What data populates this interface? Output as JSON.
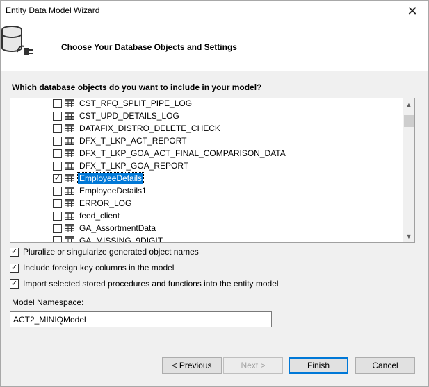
{
  "window": {
    "title": "Entity Data Model Wizard"
  },
  "header": {
    "title": "Choose Your Database Objects and Settings",
    "icon": "database-connect-icon"
  },
  "question": "Which database objects do you want to include in your model?",
  "objects": [
    {
      "label": "CST_RFQ_SPLIT_PIPE_LOG",
      "checked": false,
      "selected": false
    },
    {
      "label": "CST_UPD_DETAILS_LOG",
      "checked": false,
      "selected": false
    },
    {
      "label": "DATAFIX_DISTRO_DELETE_CHECK",
      "checked": false,
      "selected": false
    },
    {
      "label": "DFX_T_LKP_ACT_REPORT",
      "checked": false,
      "selected": false
    },
    {
      "label": "DFX_T_LKP_GOA_ACT_FINAL_COMPARISON_DATA",
      "checked": false,
      "selected": false
    },
    {
      "label": "DFX_T_LKP_GOA_REPORT",
      "checked": false,
      "selected": false
    },
    {
      "label": "EmployeeDetails",
      "checked": true,
      "selected": true
    },
    {
      "label": "EmployeeDetails1",
      "checked": false,
      "selected": false
    },
    {
      "label": "ERROR_LOG",
      "checked": false,
      "selected": false
    },
    {
      "label": "feed_client",
      "checked": false,
      "selected": false
    },
    {
      "label": "GA_AssortmentData",
      "checked": false,
      "selected": false
    },
    {
      "label": "GA_MISSING_9DIGIT",
      "checked": false,
      "selected": false
    }
  ],
  "options": {
    "pluralize": {
      "label": "Pluralize or singularize generated object names",
      "checked": true
    },
    "foreign_keys": {
      "label": "Include foreign key columns in the model",
      "checked": true
    },
    "import_procs": {
      "label": "Import selected stored procedures and functions into the entity model",
      "checked": true
    }
  },
  "namespace": {
    "label": "Model Namespace:",
    "value": "ACT2_MINIQModel"
  },
  "buttons": {
    "previous": "< Previous",
    "next": "Next >",
    "finish": "Finish",
    "cancel": "Cancel"
  },
  "colors": {
    "selection": "#0078d7",
    "background": "#f0f0f0"
  }
}
